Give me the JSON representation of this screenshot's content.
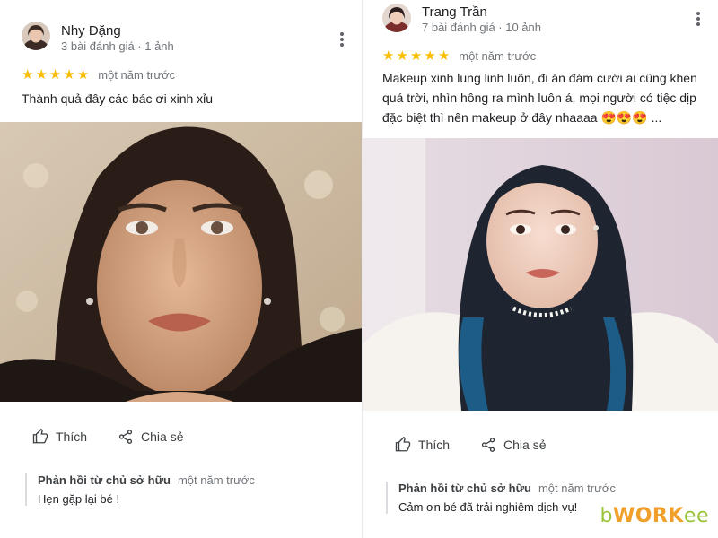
{
  "reviews": [
    {
      "reviewer_name": "Nhy Đặng",
      "reviewer_meta": "3 bài đánh giá · 1 ảnh",
      "stars": 5,
      "time": "một năm trước",
      "text": "Thành quả đây các bác ơi xinh xỉu",
      "like_label": "Thích",
      "share_label": "Chia sẻ",
      "reply_title": "Phản hồi từ chủ sở hữu",
      "reply_time": "một năm trước",
      "reply_text": "Hẹn gặp lại bé !"
    },
    {
      "reviewer_name": "Trang Trần",
      "reviewer_meta": "7 bài đánh giá · 10 ảnh",
      "stars": 5,
      "time": "một năm trước",
      "text_lines": [
        "Makeup xinh lung linh luôn, đi ăn đám cưới ai cũng khen",
        "quá trời, nhìn hông ra mình luôn á, mọi người có tiệc dịp",
        "đặc biệt thì nên makeup ở đây nhaaaa 😍😍😍 ..."
      ],
      "like_label": "Thích",
      "share_label": "Chia sẻ",
      "reply_title": "Phản hồi từ chủ sở hữu",
      "reply_time": "một năm trước",
      "reply_text": "Cảm ơn bé đã trải nghiệm dịch vụ!"
    }
  ],
  "watermark": {
    "b": "b",
    "work": "WORK",
    "ee": "ee"
  },
  "colors": {
    "star": "#fbbc04",
    "text": "#202124",
    "secondary": "#70757a",
    "icon": "#5f6368",
    "reply_border": "#dadce0"
  },
  "icons": {
    "more": "more-vert-icon",
    "like": "thumb-up-icon",
    "share": "share-icon",
    "star": "star-icon"
  }
}
